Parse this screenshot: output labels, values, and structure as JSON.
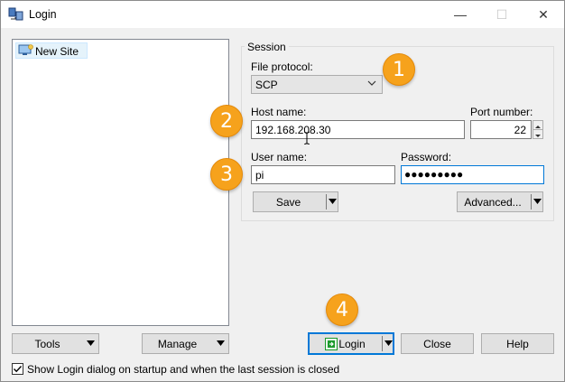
{
  "window": {
    "title": "Login",
    "minimize_glyph": "—",
    "maximize_glyph": "☐",
    "close_glyph": "✕"
  },
  "sites": [
    {
      "label": "New Site",
      "icon": "monitor-icon"
    }
  ],
  "session": {
    "group_title": "Session",
    "file_protocol_label": "File protocol:",
    "file_protocol_value": "SCP",
    "host_label": "Host name:",
    "host_value": "192.168.208.30",
    "port_label": "Port number:",
    "port_value": "22",
    "user_label": "User name:",
    "user_value": "pi",
    "password_label": "Password:",
    "password_mask": "●●●●●●●●●",
    "save_label": "Save",
    "advanced_label": "Advanced..."
  },
  "footer": {
    "tools_label": "Tools",
    "manage_label": "Manage",
    "login_label": "Login",
    "close_label": "Close",
    "help_label": "Help",
    "checkbox_label": "Show Login dialog on startup and when the last session is closed",
    "checkbox_checked": true
  },
  "annotations": [
    "1",
    "2",
    "3",
    "4"
  ],
  "colors": {
    "badge": "#f6a21c",
    "focus": "#0078d7",
    "login_icon": "#1c9a2c"
  }
}
